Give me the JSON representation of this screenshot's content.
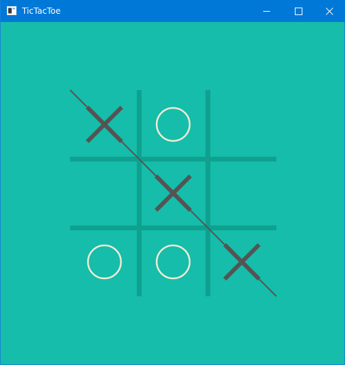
{
  "window": {
    "title": "TicTacToe"
  },
  "colors": {
    "titlebar": "#0078d7",
    "background": "#15bdaa",
    "grid": "#0fa08f",
    "x_mark": "#545454",
    "o_mark": "#f2ebd3",
    "win_line": "#545454"
  },
  "icons": {
    "app": "window-app-icon",
    "minimize": "minimize-icon",
    "maximize": "maximize-icon",
    "close": "close-icon"
  },
  "board": {
    "cells": [
      [
        "X",
        "O",
        ""
      ],
      [
        "",
        "X",
        ""
      ],
      [
        "O",
        "O",
        "X"
      ]
    ],
    "winning_line": {
      "from": [
        0,
        0
      ],
      "to": [
        2,
        2
      ]
    }
  }
}
